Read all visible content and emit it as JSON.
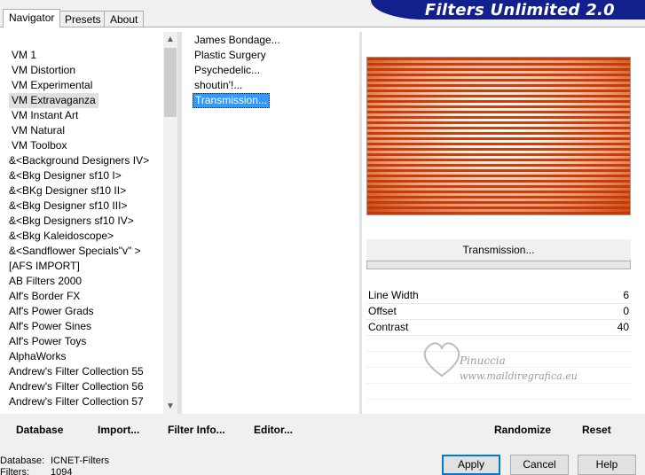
{
  "tabs": [
    "Navigator",
    "Presets",
    "About"
  ],
  "banner_title": "Filters Unlimited 2.0",
  "categories": [
    "VM 1",
    "VM Distortion",
    "VM Experimental",
    "VM Extravaganza",
    "VM Instant Art",
    "VM Natural",
    "VM Toolbox",
    "&<Background Designers IV>",
    "&<Bkg Designer sf10 I>",
    "&<BKg Designer sf10 II>",
    "&<Bkg Designer sf10 III>",
    "&<Bkg Designers sf10 IV>",
    "&<Bkg Kaleidoscope>",
    "&<Sandflower Specials\"v\" >",
    "[AFS IMPORT]",
    "AB Filters 2000",
    "Alf's Border FX",
    "Alf's Power Grads",
    "Alf's Power Sines",
    "Alf's Power Toys",
    "AlphaWorks",
    "Andrew's Filter Collection 55",
    "Andrew's Filter Collection 56",
    "Andrew's Filter Collection 57"
  ],
  "selected_category": "VM Extravaganza",
  "filters": [
    "James Bondage...",
    "Plastic Surgery",
    "Psychedelic...",
    "shoutin'!...",
    "Transmission..."
  ],
  "selected_filter": "Transmission...",
  "current_filter_name": "Transmission...",
  "params": [
    {
      "label": "Line Width",
      "value": "6"
    },
    {
      "label": "Offset",
      "value": "0"
    },
    {
      "label": "Contrast",
      "value": "40"
    }
  ],
  "watermark": {
    "line1": "Pinuccia",
    "line2": "www.maildiregrafica.eu"
  },
  "toolbar": {
    "database": "Database",
    "import": "Import...",
    "filter_info": "Filter Info...",
    "editor": "Editor...",
    "randomize": "Randomize",
    "reset": "Reset"
  },
  "status": {
    "database_label": "Database:",
    "database_value": "ICNET-Filters",
    "filters_label": "Filters:",
    "filters_value": "1094"
  },
  "dialog": {
    "apply": "Apply",
    "cancel": "Cancel",
    "help": "Help"
  },
  "colors": {
    "banner": "#12208e",
    "selection": "#3399ff",
    "preview_stripe": "#c83700"
  }
}
